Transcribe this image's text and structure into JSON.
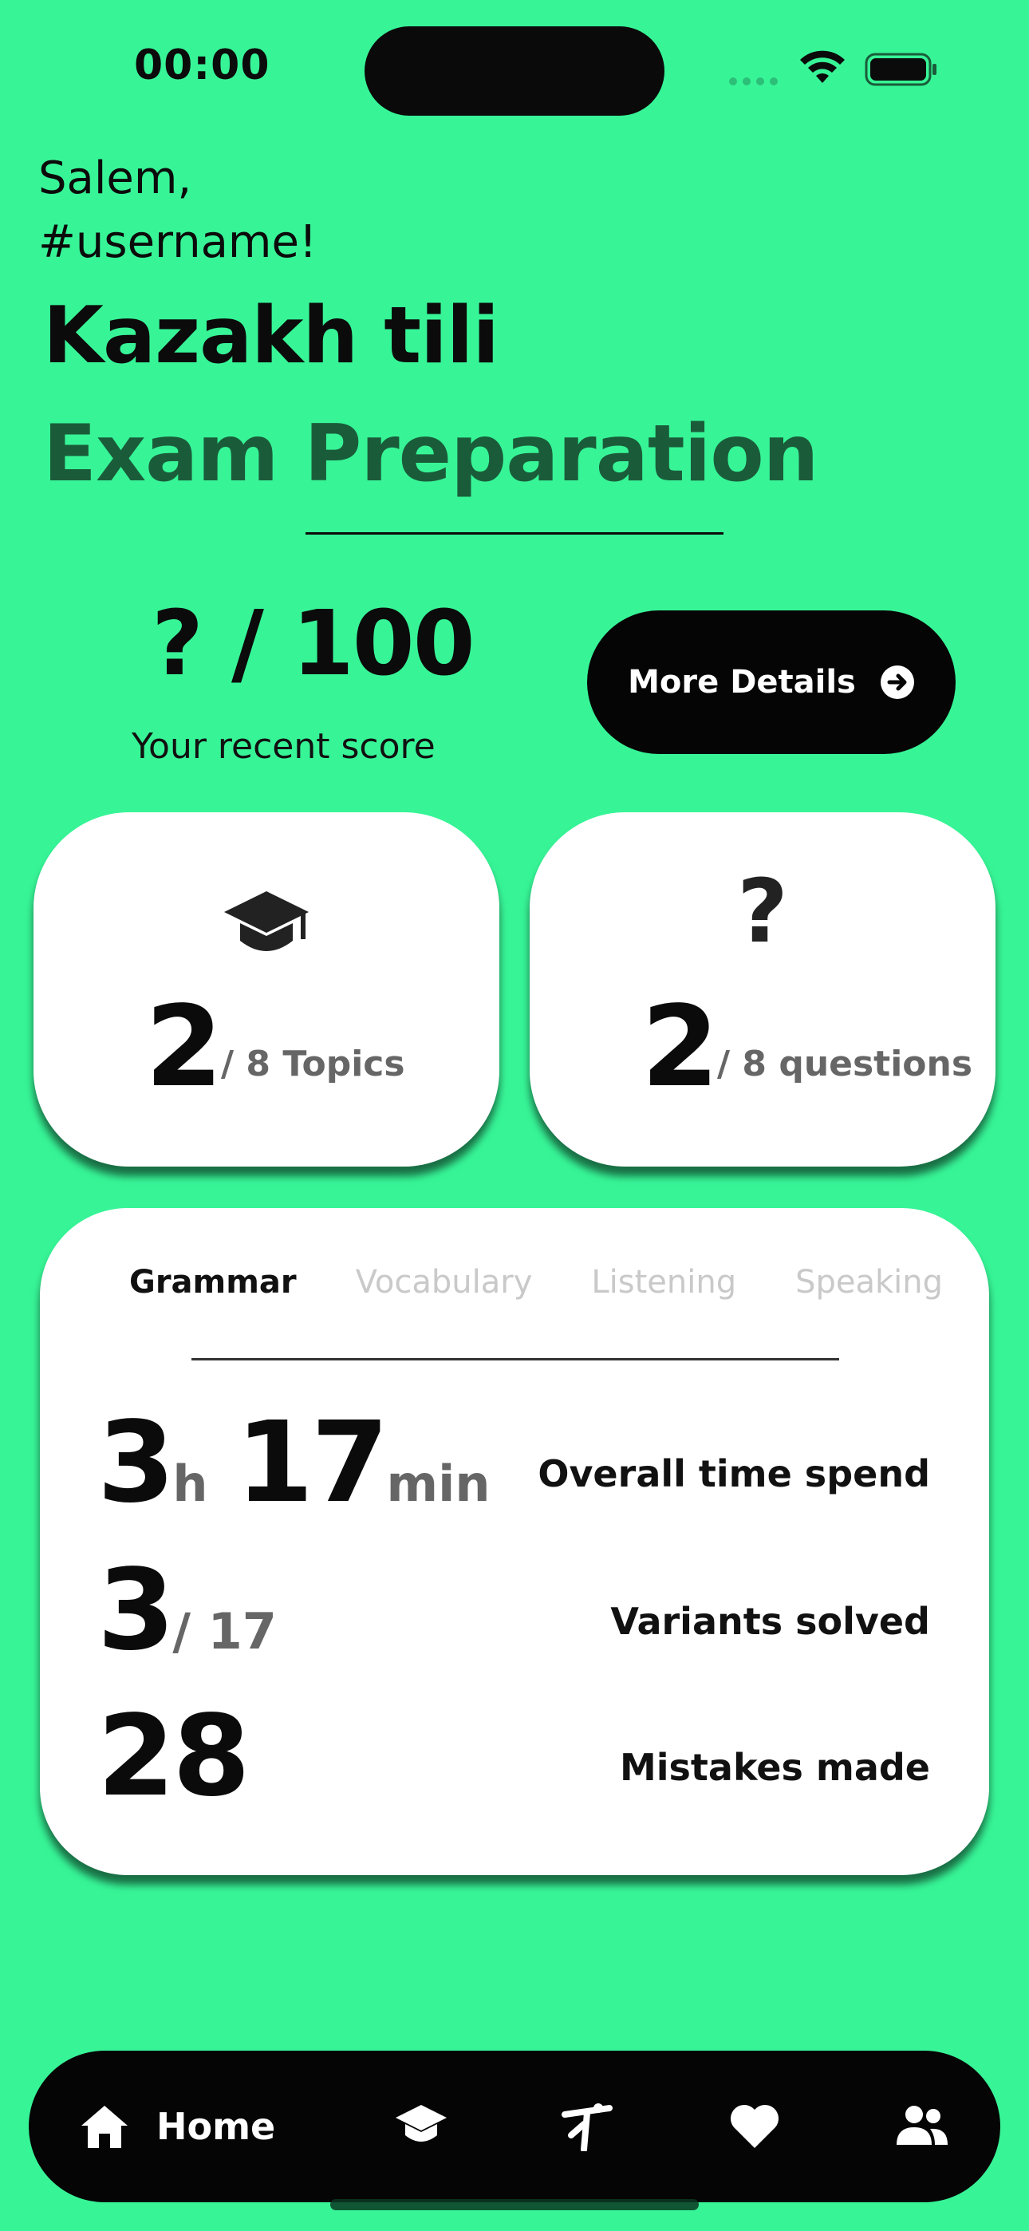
{
  "status_bar": {
    "time": "00:00"
  },
  "greeting": {
    "line1": "Salem,",
    "line2": "#username!"
  },
  "title": {
    "line1": "Kazakh tili",
    "line2": "Exam Preparation"
  },
  "score": {
    "value": "?",
    "total": "/ 100",
    "caption": "Your recent score"
  },
  "more_details_button": {
    "label": "More Details",
    "icon": "arrow-right-circle-icon"
  },
  "cards": [
    {
      "icon": "graduation-cap-icon",
      "count": "2",
      "label": "/ 8 Topics"
    },
    {
      "icon": "question-mark-icon",
      "count": "2",
      "label": "/ 8 questions"
    }
  ],
  "stats": {
    "tabs": [
      {
        "label": "Grammar",
        "active": true
      },
      {
        "label": "Vocabulary",
        "active": false
      },
      {
        "label": "Listening",
        "active": false
      },
      {
        "label": "Speaking",
        "active": false
      }
    ],
    "time": {
      "hours": "3",
      "h_unit": "h",
      "minutes": "17",
      "min_unit": "min",
      "label": "Overall time spend"
    },
    "variants": {
      "solved": "3",
      "total": "/ 17",
      "label": "Variants solved"
    },
    "mistakes": {
      "count": "28",
      "label": "Mistakes made"
    }
  },
  "nav": {
    "items": [
      {
        "label": "Home",
        "icon": "home-icon",
        "active": true
      },
      {
        "label": "",
        "icon": "graduation-cap-icon"
      },
      {
        "label": "",
        "icon": "figure-exercise-icon"
      },
      {
        "label": "",
        "icon": "heart-icon"
      },
      {
        "label": "",
        "icon": "people-icon"
      }
    ]
  },
  "colors": {
    "background": "#37F597",
    "accent_dark_green": "#1a5c3a",
    "card": "#ffffff",
    "button": "#050505"
  }
}
